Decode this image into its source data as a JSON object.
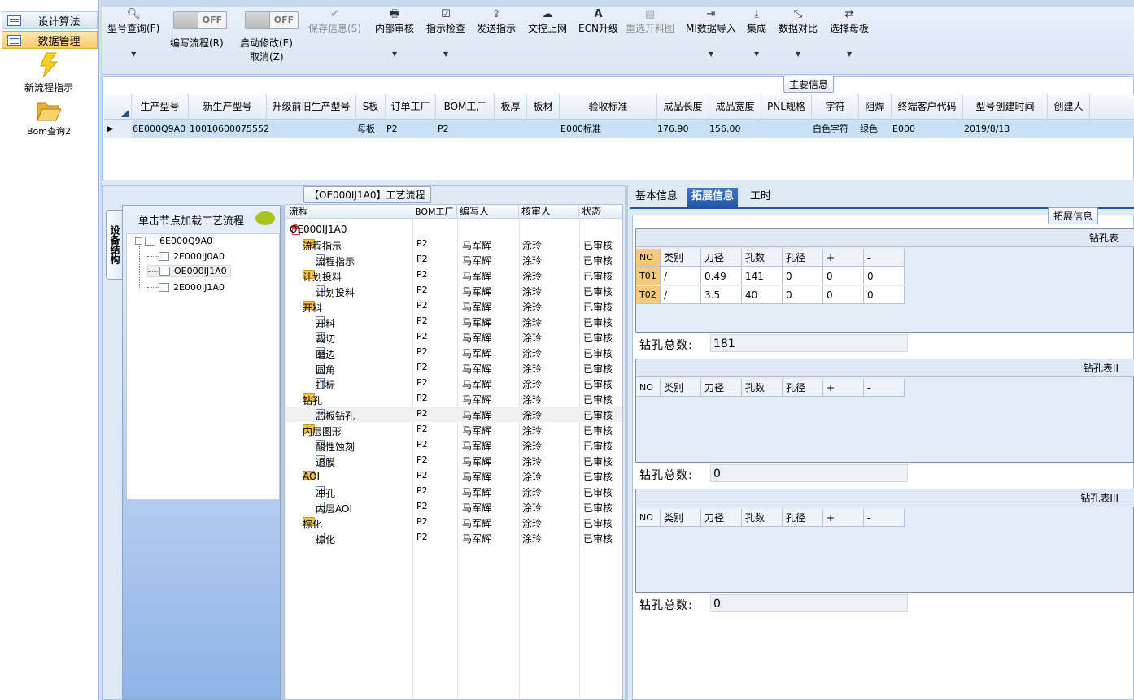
{
  "nav": {
    "header1": "设计算法",
    "header2": "数据管理",
    "items": [
      {
        "label": "新流程指示",
        "icon": "lightning-icon"
      },
      {
        "label": "Bom查询2",
        "icon": "open-folder-icon"
      }
    ]
  },
  "toolbar": {
    "model_query": "型号查询(F)",
    "edit_flow": "编写流程(R)",
    "edit_flow_toggle": "OFF",
    "start_edit": "启动修改(E)",
    "cancel": "取消(Z)",
    "start_edit_toggle": "OFF",
    "save_info": "保存信息(S)",
    "internal_audit": "内部审核",
    "instruction_check": "指示检查",
    "send_instruction": "发送指示",
    "upload_doc": "文控上网",
    "ecn_upgrade": "ECN升级",
    "reselect_cut": "重选开料图",
    "mi_import": "MI数据导入",
    "integrate": "集成",
    "data_compare": "数据对比",
    "select_mother": "选择母板"
  },
  "main_info": {
    "title": "主要信息",
    "columns": [
      "生产型号",
      "新生产型号",
      "升级前旧生产型号",
      "S板",
      "订单工厂",
      "BOM工厂",
      "板厚",
      "板材",
      "验收标准",
      "成品长度",
      "成品宽度",
      "PNL规格",
      "字符",
      "阻焊",
      "终端客户代码",
      "型号创建时间",
      "创建人"
    ],
    "row": [
      "6E000Q9A0",
      "10010600075552",
      "",
      "母板",
      "P2",
      "P2",
      "",
      "",
      "E000标准",
      "176.90",
      "156.00",
      "",
      "白色字符",
      "绿色",
      "E000",
      "2019/8/13",
      ""
    ]
  },
  "process": {
    "title": "【OE000IJ1A0】工艺流程",
    "side_tab": "设备结构",
    "tree_header": "单击节点加载工艺流程",
    "tree": [
      {
        "label": "6E000Q9A0",
        "level": 0
      },
      {
        "label": "2E000IJ0A0",
        "level": 1
      },
      {
        "label": "OE000IJ1A0",
        "level": 1
      },
      {
        "label": "2E000IJ1A0",
        "level": 1
      }
    ],
    "columns": [
      "流程",
      "BOM工厂",
      "编写人",
      "核审人",
      "状态"
    ],
    "rows": [
      {
        "name": "OE000IJ1A0",
        "type": "root",
        "bom": "",
        "author": "",
        "reviewer": "",
        "status": ""
      },
      {
        "name": "流程指示",
        "type": "folder",
        "bom": "P2",
        "author": "马军辉",
        "reviewer": "涂玲",
        "status": "已审核"
      },
      {
        "name": "流程指示",
        "type": "doc",
        "bom": "P2",
        "author": "马军辉",
        "reviewer": "涂玲",
        "status": "已审核"
      },
      {
        "name": "计划投料",
        "type": "folder",
        "bom": "P2",
        "author": "马军辉",
        "reviewer": "涂玲",
        "status": "已审核"
      },
      {
        "name": "计划投料",
        "type": "doc",
        "bom": "P2",
        "author": "马军辉",
        "reviewer": "涂玲",
        "status": "已审核"
      },
      {
        "name": "开料",
        "type": "folder",
        "bom": "P2",
        "author": "马军辉",
        "reviewer": "涂玲",
        "status": "已审核"
      },
      {
        "name": "开料",
        "type": "doc",
        "bom": "P2",
        "author": "马军辉",
        "reviewer": "涂玲",
        "status": "已审核"
      },
      {
        "name": "裁切",
        "type": "doc",
        "bom": "P2",
        "author": "马军辉",
        "reviewer": "涂玲",
        "status": "已审核"
      },
      {
        "name": "磨边",
        "type": "doc",
        "bom": "P2",
        "author": "马军辉",
        "reviewer": "涂玲",
        "status": "已审核"
      },
      {
        "name": "圆角",
        "type": "doc",
        "bom": "P2",
        "author": "马军辉",
        "reviewer": "涂玲",
        "status": "已审核"
      },
      {
        "name": "打标",
        "type": "doc",
        "bom": "P2",
        "author": "马军辉",
        "reviewer": "涂玲",
        "status": "已审核"
      },
      {
        "name": "钻孔",
        "type": "folder",
        "bom": "P2",
        "author": "马军辉",
        "reviewer": "涂玲",
        "status": "已审核"
      },
      {
        "name": "芯板钻孔",
        "type": "doc",
        "bom": "P2",
        "author": "马军辉",
        "reviewer": "涂玲",
        "status": "已审核"
      },
      {
        "name": "内层图形",
        "type": "folder",
        "bom": "P2",
        "author": "马军辉",
        "reviewer": "涂玲",
        "status": "已审核"
      },
      {
        "name": "酸性蚀刻",
        "type": "doc",
        "bom": "P2",
        "author": "马军辉",
        "reviewer": "涂玲",
        "status": "已审核"
      },
      {
        "name": "退膜",
        "type": "doc",
        "bom": "P2",
        "author": "马军辉",
        "reviewer": "涂玲",
        "status": "已审核"
      },
      {
        "name": "AOI",
        "type": "folder",
        "bom": "P2",
        "author": "马军辉",
        "reviewer": "涂玲",
        "status": "已审核"
      },
      {
        "name": "冲孔",
        "type": "doc",
        "bom": "P2",
        "author": "马军辉",
        "reviewer": "涂玲",
        "status": "已审核"
      },
      {
        "name": "内层AOI",
        "type": "doc",
        "bom": "P2",
        "author": "马军辉",
        "reviewer": "涂玲",
        "status": "已审核"
      },
      {
        "name": "棕化",
        "type": "folder",
        "bom": "P2",
        "author": "马军辉",
        "reviewer": "涂玲",
        "status": "已审核"
      },
      {
        "name": "棕化",
        "type": "doc",
        "bom": "P2",
        "author": "马军辉",
        "reviewer": "涂玲",
        "status": "已审核"
      }
    ]
  },
  "detail": {
    "tabs": [
      "基本信息",
      "拓展信息",
      "工时"
    ],
    "active_tab": "拓展信息",
    "group_title": "拓展信息",
    "drill_tables": [
      {
        "title": "钻孔表",
        "columns": [
          "NO",
          "类别",
          "刀径",
          "孔数",
          "孔径",
          "+",
          "-"
        ],
        "rows": [
          [
            "T01",
            "/",
            "0.49",
            "141",
            "0",
            "0",
            "0"
          ],
          [
            "T02",
            "/",
            "3.5",
            "40",
            "0",
            "0",
            "0"
          ]
        ],
        "total_label": "钻孔总数:",
        "total": "181"
      },
      {
        "title": "钻孔表II",
        "columns": [
          "NO",
          "类别",
          "刀径",
          "孔数",
          "孔径",
          "+",
          "-"
        ],
        "rows": [],
        "total_label": "钻孔总数:",
        "total": "0"
      },
      {
        "title": "钻孔表III",
        "columns": [
          "NO",
          "类别",
          "刀径",
          "孔数",
          "孔径",
          "+",
          "-"
        ],
        "rows": [],
        "total_label": "钻孔总数:",
        "total": "0"
      }
    ]
  }
}
